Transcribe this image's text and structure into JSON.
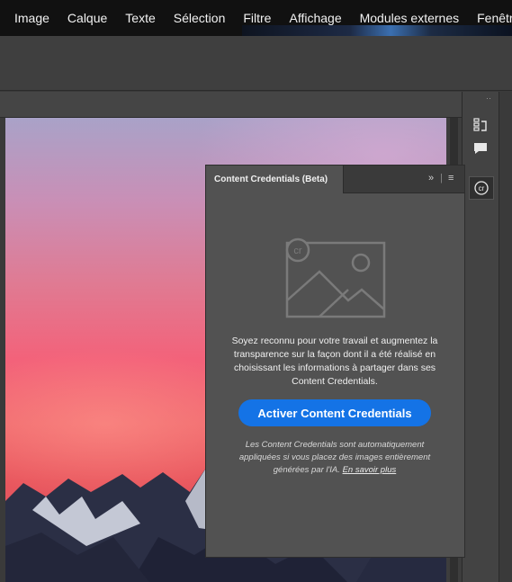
{
  "menubar": {
    "items": [
      "Image",
      "Calque",
      "Texte",
      "Sélection",
      "Filtre",
      "Affichage",
      "Modules externes",
      "Fenêtre"
    ]
  },
  "dock": {
    "icons": [
      "history-icon",
      "comment-icon",
      "content-credentials-icon"
    ],
    "grip": "··"
  },
  "panel": {
    "title": "Content Credentials (Beta)",
    "expand_label": "»",
    "menu_label": "≡",
    "illustration_badge": "cr",
    "description": "Soyez reconnu pour votre travail et augmentez la transparence sur la façon dont il a été réalisé en choisissant les informations à partager dans ses Content Credentials.",
    "button_label": "Activer Content Credentials",
    "note": "Les Content Credentials sont automatiquement appliquées si vous placez des images entièrement générées par l'IA.",
    "learn_more": "En savoir plus"
  },
  "colors": {
    "accent": "#1473e6",
    "panel_bg": "#525252",
    "menubar_bg": "#111111"
  }
}
